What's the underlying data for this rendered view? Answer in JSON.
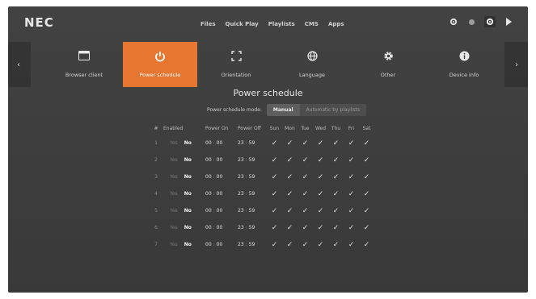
{
  "brand": "NEC",
  "nav": [
    "Files",
    "Quick Play",
    "Playlists",
    "CMS",
    "Apps"
  ],
  "top_icons": [
    "gear-icon",
    "circle-icon",
    "gear-icon",
    "play-icon"
  ],
  "tiles": [
    {
      "label": "Browser client",
      "icon": "window-icon",
      "active": false
    },
    {
      "label": "Power schedule",
      "icon": "power-icon",
      "active": true
    },
    {
      "label": "Orientation",
      "icon": "orientation-icon",
      "active": false
    },
    {
      "label": "Language",
      "icon": "globe-icon",
      "active": false
    },
    {
      "label": "Other",
      "icon": "gear-icon",
      "active": false
    },
    {
      "label": "Device info",
      "icon": "info-icon",
      "active": false
    }
  ],
  "page_title": "Power schedule",
  "mode": {
    "label": "Power schedule mode:",
    "options": [
      "Manual",
      "Automatic by playlists"
    ],
    "selected": "Manual"
  },
  "table": {
    "headers": [
      "#",
      "Enabled",
      "Power On",
      "Power Off",
      "Sun",
      "Mon",
      "Tue",
      "Wed",
      "Thu",
      "Fri",
      "Sat"
    ],
    "rows": [
      {
        "n": "1",
        "yes": "Yes",
        "no": "No",
        "on_h": "00",
        "on_m": "00",
        "off_h": "23",
        "off_m": "59"
      },
      {
        "n": "2",
        "yes": "Yes",
        "no": "No",
        "on_h": "00",
        "on_m": "00",
        "off_h": "23",
        "off_m": "59"
      },
      {
        "n": "3",
        "yes": "Yes",
        "no": "No",
        "on_h": "00",
        "on_m": "00",
        "off_h": "23",
        "off_m": "59"
      },
      {
        "n": "4",
        "yes": "Yes",
        "no": "No",
        "on_h": "00",
        "on_m": "00",
        "off_h": "23",
        "off_m": "59"
      },
      {
        "n": "5",
        "yes": "Yes",
        "no": "No",
        "on_h": "00",
        "on_m": "00",
        "off_h": "23",
        "off_m": "59"
      },
      {
        "n": "6",
        "yes": "Yes",
        "no": "No",
        "on_h": "00",
        "on_m": "00",
        "off_h": "23",
        "off_m": "59"
      },
      {
        "n": "7",
        "yes": "Yes",
        "no": "No",
        "on_h": "00",
        "on_m": "00",
        "off_h": "23",
        "off_m": "59"
      }
    ]
  },
  "colors": {
    "accent": "#e8742c",
    "background": "#3c3c3c"
  }
}
